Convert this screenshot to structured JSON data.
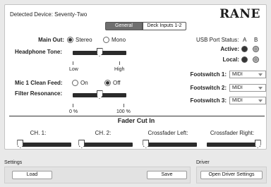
{
  "header": {
    "device_label": "Detected Device: Seventy-Two",
    "logo_text": "RANE"
  },
  "tabs": [
    {
      "label": "General",
      "active": true
    },
    {
      "label": "Deck Inputs 1-2",
      "active": false
    }
  ],
  "left": {
    "main_out_label": "Main Out:",
    "main_out_options": [
      "Stereo",
      "Mono"
    ],
    "main_out_selected": "Stereo",
    "headphone_tone_label": "Headphone Tone:",
    "headphone_tone_value": 0.5,
    "headphone_low": "Low",
    "headphone_high": "High",
    "mic_clean_label": "Mic 1 Clean Feed:",
    "mic_clean_options": [
      "On",
      "Off"
    ],
    "mic_clean_selected": "Off",
    "filter_res_label": "Filter Resonance:",
    "filter_res_value": 0.5,
    "filter_min": "0 %",
    "filter_max": "100 %"
  },
  "right": {
    "usb_status_label": "USB Port Status:",
    "col_a": "A",
    "col_b": "B",
    "active_label": "Active:",
    "local_label": "Local:",
    "footswitches": [
      {
        "label": "Footswitch 1:",
        "value": "MIDI"
      },
      {
        "label": "Footswitch 2:",
        "value": "MIDI"
      },
      {
        "label": "Footswitch 3:",
        "value": "MIDI"
      }
    ]
  },
  "fader_cut_in": {
    "title": "Fader Cut In",
    "faders": [
      {
        "label": "CH. 1:",
        "value": 0.05
      },
      {
        "label": "CH. 2:",
        "value": 0.05
      },
      {
        "label": "Crossfader Left:",
        "value": 0.05
      },
      {
        "label": "Crossfader Right:",
        "value": 0.95
      }
    ]
  },
  "settings": {
    "label": "Settings",
    "load_label": "Load",
    "save_label": "Save"
  },
  "driver": {
    "label": "Driver",
    "open_label": "Open Driver Settings"
  }
}
